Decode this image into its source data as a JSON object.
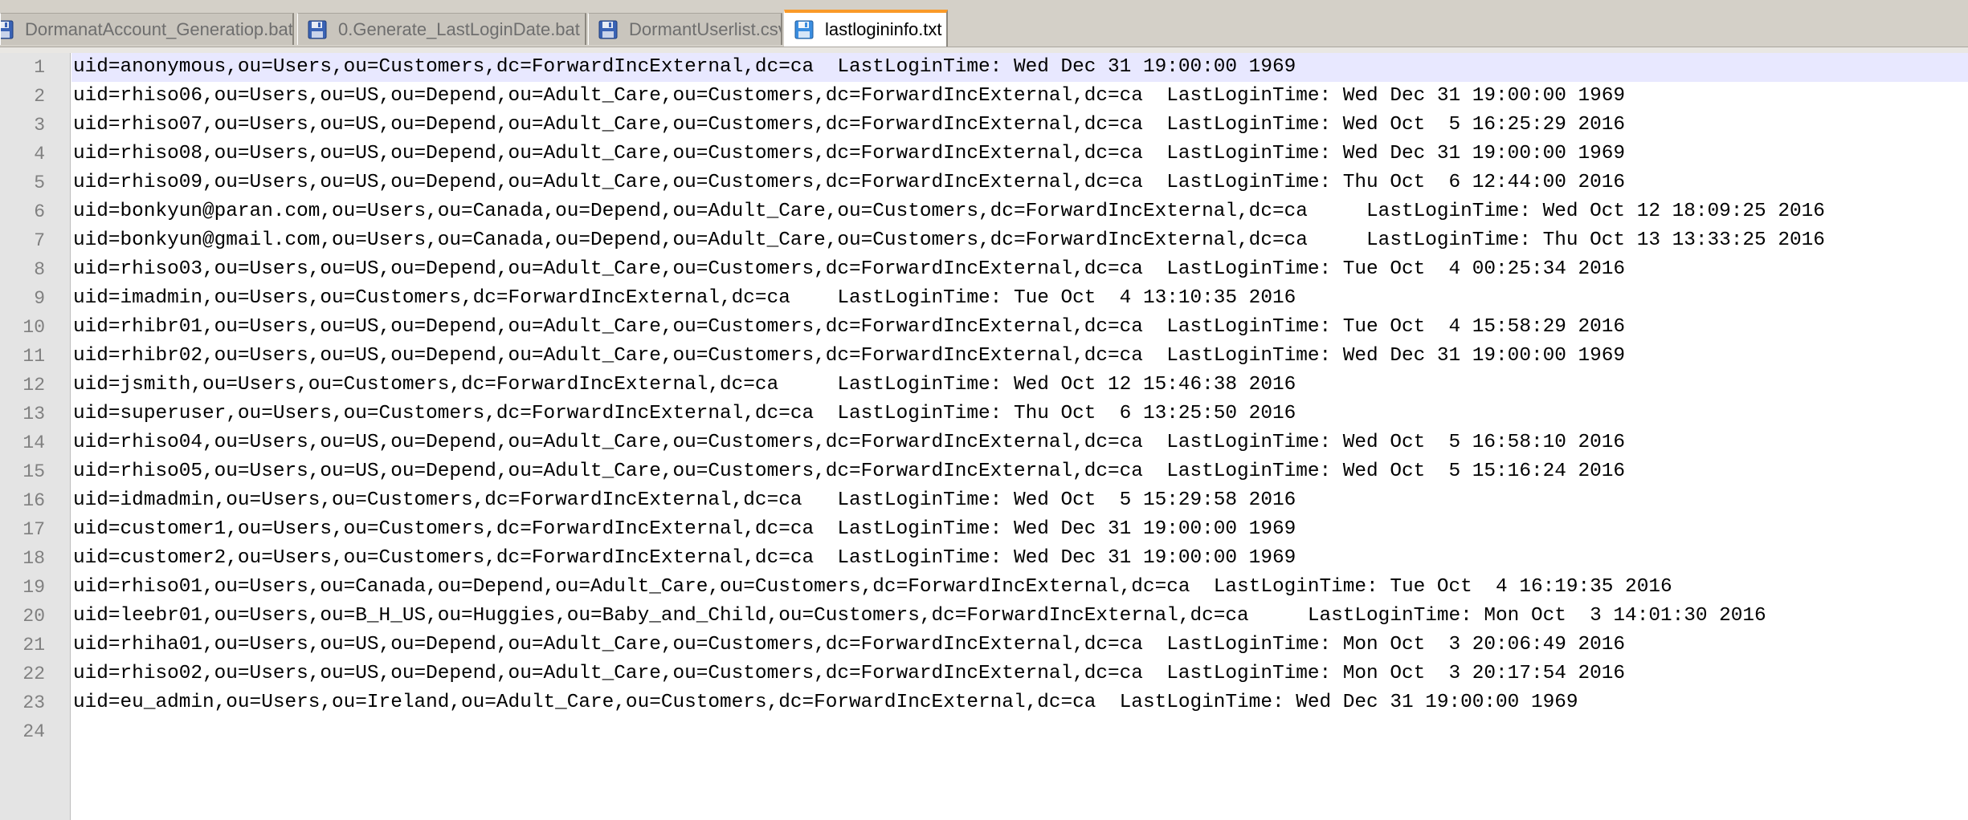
{
  "tabs": [
    {
      "label": "DormanatAccount_Generatiop.bat",
      "icon": "floppy-disk-icon",
      "active": false
    },
    {
      "label": "0.Generate_LastLoginDate.bat",
      "icon": "floppy-disk-icon",
      "active": false
    },
    {
      "label": "DormantUserlist.csv",
      "icon": "floppy-disk-icon",
      "active": false
    },
    {
      "label": "lastlogininfo.txt",
      "icon": "floppy-disk-icon",
      "active": true
    }
  ],
  "editor": {
    "current_line": 1,
    "lines": [
      {
        "num": "1",
        "text": "uid=anonymous,ou=Users,ou=Customers,dc=ForwardIncExternal,dc=ca  LastLoginTime: Wed Dec 31 19:00:00 1969"
      },
      {
        "num": "2",
        "text": "uid=rhiso06,ou=Users,ou=US,ou=Depend,ou=Adult_Care,ou=Customers,dc=ForwardIncExternal,dc=ca  LastLoginTime: Wed Dec 31 19:00:00 1969"
      },
      {
        "num": "3",
        "text": "uid=rhiso07,ou=Users,ou=US,ou=Depend,ou=Adult_Care,ou=Customers,dc=ForwardIncExternal,dc=ca  LastLoginTime: Wed Oct  5 16:25:29 2016"
      },
      {
        "num": "4",
        "text": "uid=rhiso08,ou=Users,ou=US,ou=Depend,ou=Adult_Care,ou=Customers,dc=ForwardIncExternal,dc=ca  LastLoginTime: Wed Dec 31 19:00:00 1969"
      },
      {
        "num": "5",
        "text": "uid=rhiso09,ou=Users,ou=US,ou=Depend,ou=Adult_Care,ou=Customers,dc=ForwardIncExternal,dc=ca  LastLoginTime: Thu Oct  6 12:44:00 2016"
      },
      {
        "num": "6",
        "text": "uid=bonkyun@paran.com,ou=Users,ou=Canada,ou=Depend,ou=Adult_Care,ou=Customers,dc=ForwardIncExternal,dc=ca     LastLoginTime: Wed Oct 12 18:09:25 2016"
      },
      {
        "num": "7",
        "text": "uid=bonkyun@gmail.com,ou=Users,ou=Canada,ou=Depend,ou=Adult_Care,ou=Customers,dc=ForwardIncExternal,dc=ca     LastLoginTime: Thu Oct 13 13:33:25 2016"
      },
      {
        "num": "8",
        "text": "uid=rhiso03,ou=Users,ou=US,ou=Depend,ou=Adult_Care,ou=Customers,dc=ForwardIncExternal,dc=ca  LastLoginTime: Tue Oct  4 00:25:34 2016"
      },
      {
        "num": "9",
        "text": "uid=imadmin,ou=Users,ou=Customers,dc=ForwardIncExternal,dc=ca    LastLoginTime: Tue Oct  4 13:10:35 2016"
      },
      {
        "num": "10",
        "text": "uid=rhibr01,ou=Users,ou=US,ou=Depend,ou=Adult_Care,ou=Customers,dc=ForwardIncExternal,dc=ca  LastLoginTime: Tue Oct  4 15:58:29 2016"
      },
      {
        "num": "11",
        "text": "uid=rhibr02,ou=Users,ou=US,ou=Depend,ou=Adult_Care,ou=Customers,dc=ForwardIncExternal,dc=ca  LastLoginTime: Wed Dec 31 19:00:00 1969"
      },
      {
        "num": "12",
        "text": "uid=jsmith,ou=Users,ou=Customers,dc=ForwardIncExternal,dc=ca     LastLoginTime: Wed Oct 12 15:46:38 2016"
      },
      {
        "num": "13",
        "text": "uid=superuser,ou=Users,ou=Customers,dc=ForwardIncExternal,dc=ca  LastLoginTime: Thu Oct  6 13:25:50 2016"
      },
      {
        "num": "14",
        "text": "uid=rhiso04,ou=Users,ou=US,ou=Depend,ou=Adult_Care,ou=Customers,dc=ForwardIncExternal,dc=ca  LastLoginTime: Wed Oct  5 16:58:10 2016"
      },
      {
        "num": "15",
        "text": "uid=rhiso05,ou=Users,ou=US,ou=Depend,ou=Adult_Care,ou=Customers,dc=ForwardIncExternal,dc=ca  LastLoginTime: Wed Oct  5 15:16:24 2016"
      },
      {
        "num": "16",
        "text": "uid=idmadmin,ou=Users,ou=Customers,dc=ForwardIncExternal,dc=ca   LastLoginTime: Wed Oct  5 15:29:58 2016"
      },
      {
        "num": "17",
        "text": "uid=customer1,ou=Users,ou=Customers,dc=ForwardIncExternal,dc=ca  LastLoginTime: Wed Dec 31 19:00:00 1969"
      },
      {
        "num": "18",
        "text": "uid=customer2,ou=Users,ou=Customers,dc=ForwardIncExternal,dc=ca  LastLoginTime: Wed Dec 31 19:00:00 1969"
      },
      {
        "num": "19",
        "text": "uid=rhiso01,ou=Users,ou=Canada,ou=Depend,ou=Adult_Care,ou=Customers,dc=ForwardIncExternal,dc=ca  LastLoginTime: Tue Oct  4 16:19:35 2016"
      },
      {
        "num": "20",
        "text": "uid=leebr01,ou=Users,ou=B_H_US,ou=Huggies,ou=Baby_and_Child,ou=Customers,dc=ForwardIncExternal,dc=ca     LastLoginTime: Mon Oct  3 14:01:30 2016"
      },
      {
        "num": "21",
        "text": "uid=rhiha01,ou=Users,ou=US,ou=Depend,ou=Adult_Care,ou=Customers,dc=ForwardIncExternal,dc=ca  LastLoginTime: Mon Oct  3 20:06:49 2016"
      },
      {
        "num": "22",
        "text": "uid=rhiso02,ou=Users,ou=US,ou=Depend,ou=Adult_Care,ou=Customers,dc=ForwardIncExternal,dc=ca  LastLoginTime: Mon Oct  3 20:17:54 2016"
      },
      {
        "num": "23",
        "text": "uid=eu_admin,ou=Users,ou=Ireland,ou=Adult_Care,ou=Customers,dc=ForwardIncExternal,dc=ca  LastLoginTime: Wed Dec 31 19:00:00 1969"
      },
      {
        "num": "24",
        "text": ""
      }
    ]
  },
  "colors": {
    "active_tab_accent": "#fa9a28",
    "current_line_highlight": "#e8e8ff",
    "gutter_background": "#e4e4e4",
    "line_number_text": "#808080"
  }
}
